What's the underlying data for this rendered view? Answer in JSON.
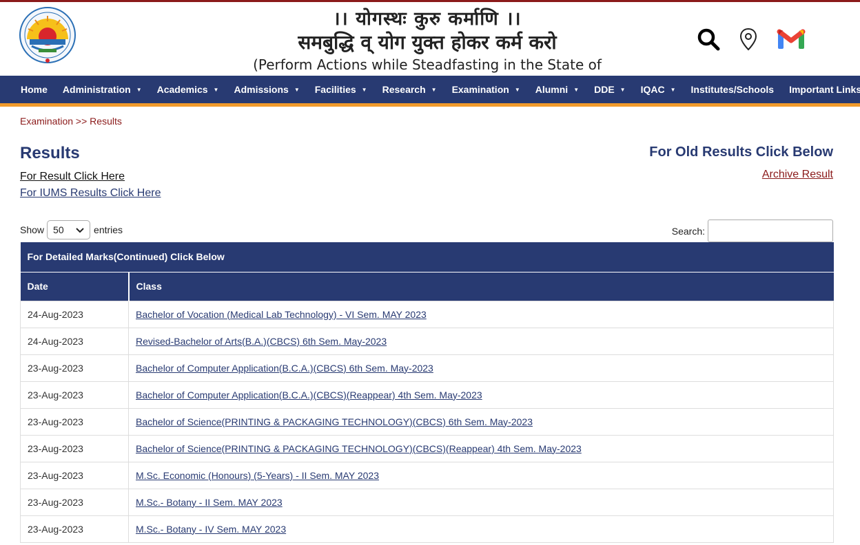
{
  "header": {
    "logo_name": "university-logo",
    "motto_line1": "।। योगस्थः कुरु कर्माणि ।।",
    "motto_line2": "समबुद्धि व् योग युक्त होकर कर्म करो",
    "motto_line3": "(Perform Actions while Steadfasting in the State of Yoga)",
    "icons": [
      "search-icon",
      "map-pin-icon",
      "gmail-icon"
    ]
  },
  "nav": {
    "items": [
      {
        "label": "Home",
        "dropdown": false
      },
      {
        "label": "Administration",
        "dropdown": true
      },
      {
        "label": "Academics",
        "dropdown": true
      },
      {
        "label": "Admissions",
        "dropdown": true
      },
      {
        "label": "Facilities",
        "dropdown": true
      },
      {
        "label": "Research",
        "dropdown": true
      },
      {
        "label": "Examination",
        "dropdown": true
      },
      {
        "label": "Alumni",
        "dropdown": true
      },
      {
        "label": "DDE",
        "dropdown": true
      },
      {
        "label": "IQAC",
        "dropdown": true
      },
      {
        "label": "Institutes/Schools",
        "dropdown": false
      },
      {
        "label": "Important Links",
        "dropdown": true
      }
    ],
    "caret_glyph": "▼"
  },
  "breadcrumb": {
    "text": "Examination >> Results"
  },
  "main": {
    "title": "Results",
    "result_link": "For Result Click Here",
    "iums_link": "For IUMS Results Click Here",
    "old_results_title": "For Old Results Click Below",
    "archive_link": "Archive Result"
  },
  "table_controls": {
    "show_label": "Show",
    "entries_value": "50",
    "entries_label": "entries",
    "search_label": "Search:",
    "search_value": ""
  },
  "table": {
    "caption": "For Detailed Marks(Continued) Click Below",
    "columns": [
      "Date",
      "Class"
    ],
    "rows": [
      {
        "date": "24-Aug-2023",
        "class": "Bachelor of Vocation (Medical Lab Technology) - VI Sem. MAY 2023"
      },
      {
        "date": "24-Aug-2023",
        "class": "Revised-Bachelor of Arts(B.A.)(CBCS) 6th Sem. May-2023"
      },
      {
        "date": "23-Aug-2023",
        "class": "Bachelor of Computer Application(B.C.A.)(CBCS) 6th Sem. May-2023"
      },
      {
        "date": "23-Aug-2023",
        "class": "Bachelor of Computer Application(B.C.A.)(CBCS)(Reappear) 4th Sem. May-2023"
      },
      {
        "date": "23-Aug-2023",
        "class": "Bachelor of Science(PRINTING & PACKAGING TECHNOLOGY)(CBCS) 6th Sem. May-2023"
      },
      {
        "date": "23-Aug-2023",
        "class": "Bachelor of Science(PRINTING & PACKAGING TECHNOLOGY)(CBCS)(Reappear) 4th Sem. May-2023"
      },
      {
        "date": "23-Aug-2023",
        "class": "M.Sc. Economic (Honours) (5-Years) - II Sem. MAY 2023"
      },
      {
        "date": "23-Aug-2023",
        "class": "M.Sc.- Botany - II Sem. MAY 2023"
      },
      {
        "date": "23-Aug-2023",
        "class": "M.Sc.- Botany - IV Sem. MAY 2023"
      }
    ]
  },
  "colors": {
    "nav_bg": "#283a72",
    "nav_underline": "#f19a2b",
    "breadcrumb": "#8b1a1a",
    "title": "#283a72"
  }
}
